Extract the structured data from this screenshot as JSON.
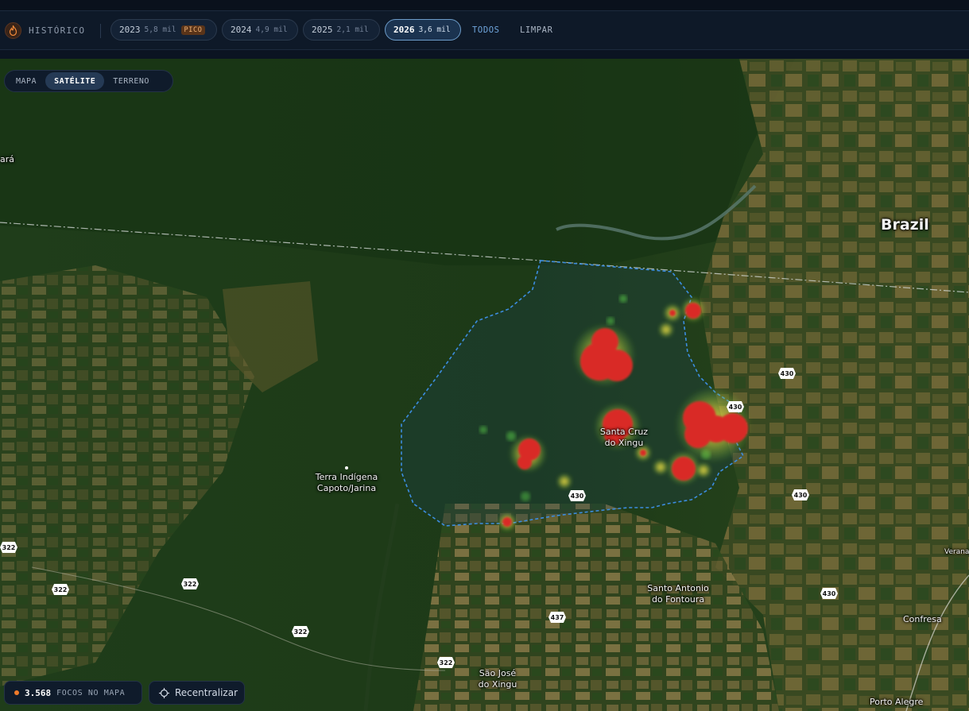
{
  "history": {
    "icon": "flame-icon",
    "label": "HISTÓRICO",
    "years": [
      {
        "year": "2023",
        "count": "5,8 mil",
        "badge": "PICO",
        "active": false
      },
      {
        "year": "2024",
        "count": "4,9 mil",
        "active": false
      },
      {
        "year": "2025",
        "count": "2,1 mil",
        "active": false
      },
      {
        "year": "2026",
        "count": "3,6 mil",
        "active": true
      }
    ],
    "all_label": "TODOS",
    "clear_label": "LIMPAR"
  },
  "map_type": {
    "options": [
      "MAPA",
      "SATÉLITE",
      "TERRENO"
    ],
    "selected": "SATÉLITE"
  },
  "map_labels": {
    "brazil": "Brazil",
    "para_fragment": "ará",
    "terra_indigena_1": "Terra Indígena",
    "terra_indigena_2": "Capoto/Jarina",
    "santa_cruz_1": "Santa Cruz",
    "santa_cruz_2": "do Xingu",
    "santo_antonio_1": "Santo Antonio",
    "santo_antonio_2": "do Fontoura",
    "confresa": "Confresa",
    "sao_jose_1": "São José",
    "sao_jose_2": "do Xingu",
    "porto_alegre": "Porto Alegre",
    "vera_fragment": "Verana"
  },
  "roads": {
    "br430": "430",
    "br322": "322",
    "br437": "437",
    "br430_small": "430"
  },
  "footer": {
    "focos_count": "3.568",
    "focos_label": "FOCOS NO MAPA",
    "recenter_label": "Recentralizar"
  },
  "colors": {
    "accent": "#6d9cc9",
    "fire_hotspot": "#d92a26",
    "fire_glow": "#e8b330",
    "boundary": "#3c8de0",
    "badge_bg": "#5a3419"
  }
}
